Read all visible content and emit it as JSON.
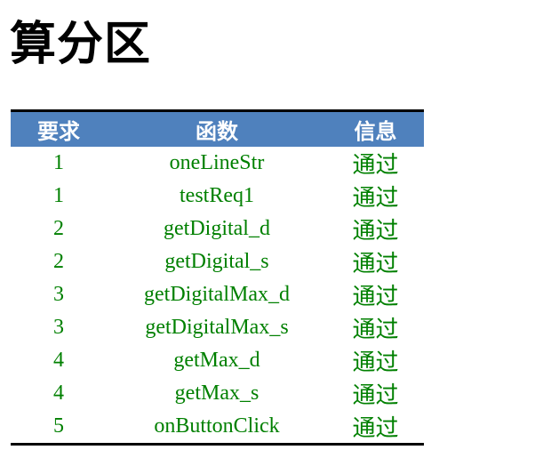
{
  "title": "算分区",
  "table": {
    "headers": [
      "要求",
      "函数",
      "信息"
    ],
    "rows": [
      {
        "req": "1",
        "func": "oneLineStr",
        "info": "通过"
      },
      {
        "req": "1",
        "func": "testReq1",
        "info": "通过"
      },
      {
        "req": "2",
        "func": "getDigital_d",
        "info": "通过"
      },
      {
        "req": "2",
        "func": "getDigital_s",
        "info": "通过"
      },
      {
        "req": "3",
        "func": "getDigitalMax_d",
        "info": "通过"
      },
      {
        "req": "3",
        "func": "getDigitalMax_s",
        "info": "通过"
      },
      {
        "req": "4",
        "func": "getMax_d",
        "info": "通过"
      },
      {
        "req": "4",
        "func": "getMax_s",
        "info": "通过"
      },
      {
        "req": "5",
        "func": "onButtonClick",
        "info": "通过"
      }
    ]
  },
  "colors": {
    "header_bg": "#4f81bd",
    "header_text": "#ffffff",
    "pass_text": "#008000",
    "border": "#000000"
  }
}
